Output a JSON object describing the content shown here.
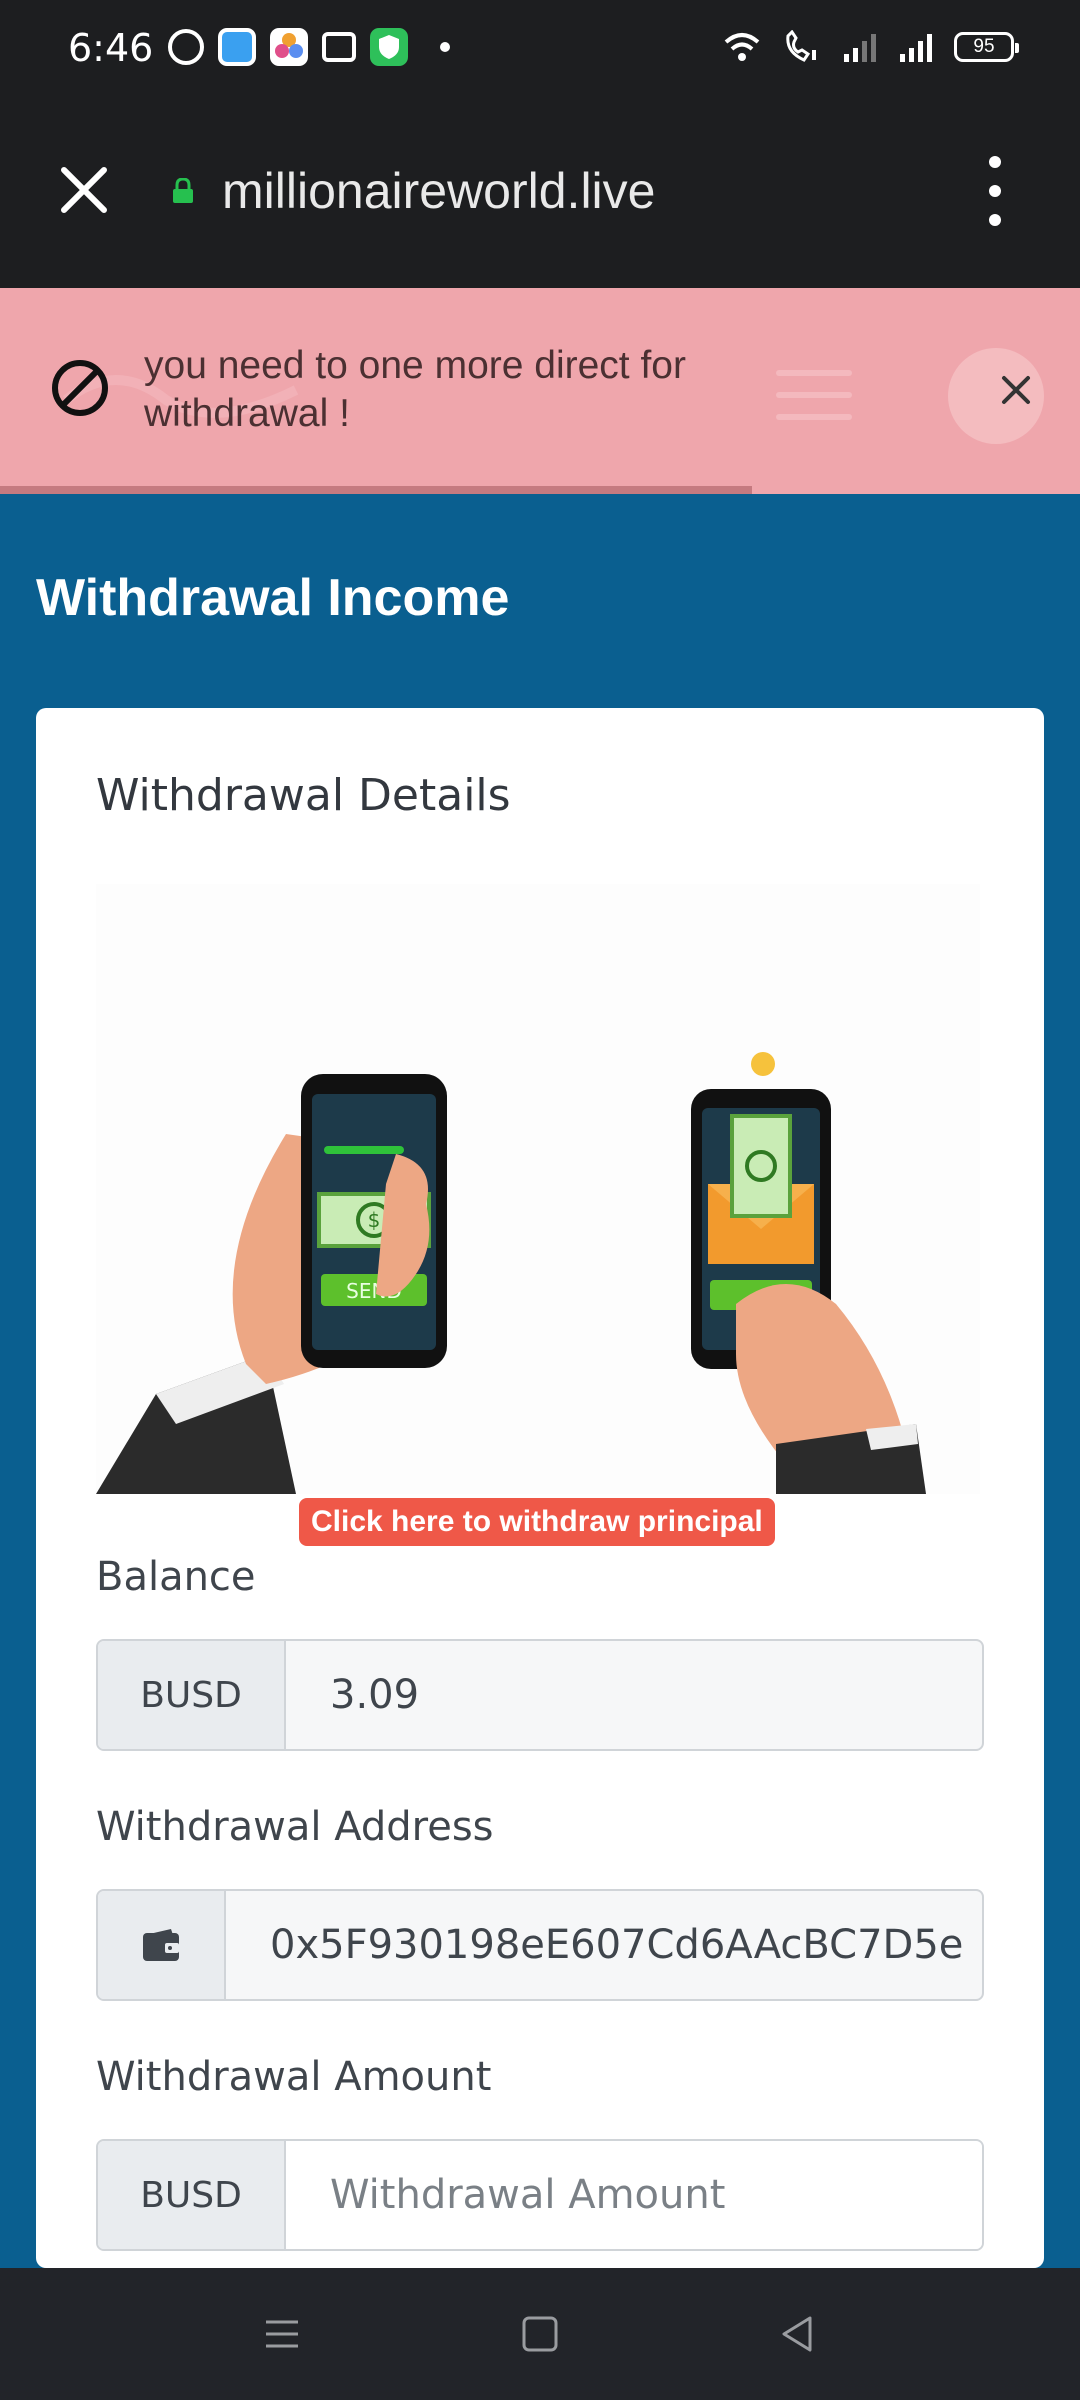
{
  "status_bar": {
    "time": "6:46",
    "battery": "95",
    "notification_icons": [
      "whatsapp-icon",
      "messenger-icon",
      "photos-icon",
      "message-icon",
      "shield-icon",
      "dot-icon"
    ],
    "system_icons": [
      "wifi-icon",
      "wifi-call-icon",
      "signal-icon",
      "signal-icon"
    ]
  },
  "browser": {
    "url": "millionaireworld.live"
  },
  "alert": {
    "message": "you need to one more direct for withdrawal !"
  },
  "page": {
    "title": "Withdrawal Income"
  },
  "card": {
    "title": "Withdrawal Details",
    "principal_button": "Click here to withdraw principal",
    "illustration": {
      "send_label": "SEND"
    },
    "balance": {
      "label": "Balance",
      "currency": "BUSD",
      "value": "3.09"
    },
    "address": {
      "label": "Withdrawal Address",
      "value": "0x5F930198eE607Cd6AAcBC7D5e"
    },
    "amount": {
      "label": "Withdrawal Amount",
      "currency": "BUSD",
      "placeholder": "Withdrawal Amount"
    }
  },
  "colors": {
    "primary_bg": "#0a5f90",
    "alert_bg": "#f4babe",
    "button_red": "#ef5848",
    "chrome_dark": "#1d1e20"
  }
}
